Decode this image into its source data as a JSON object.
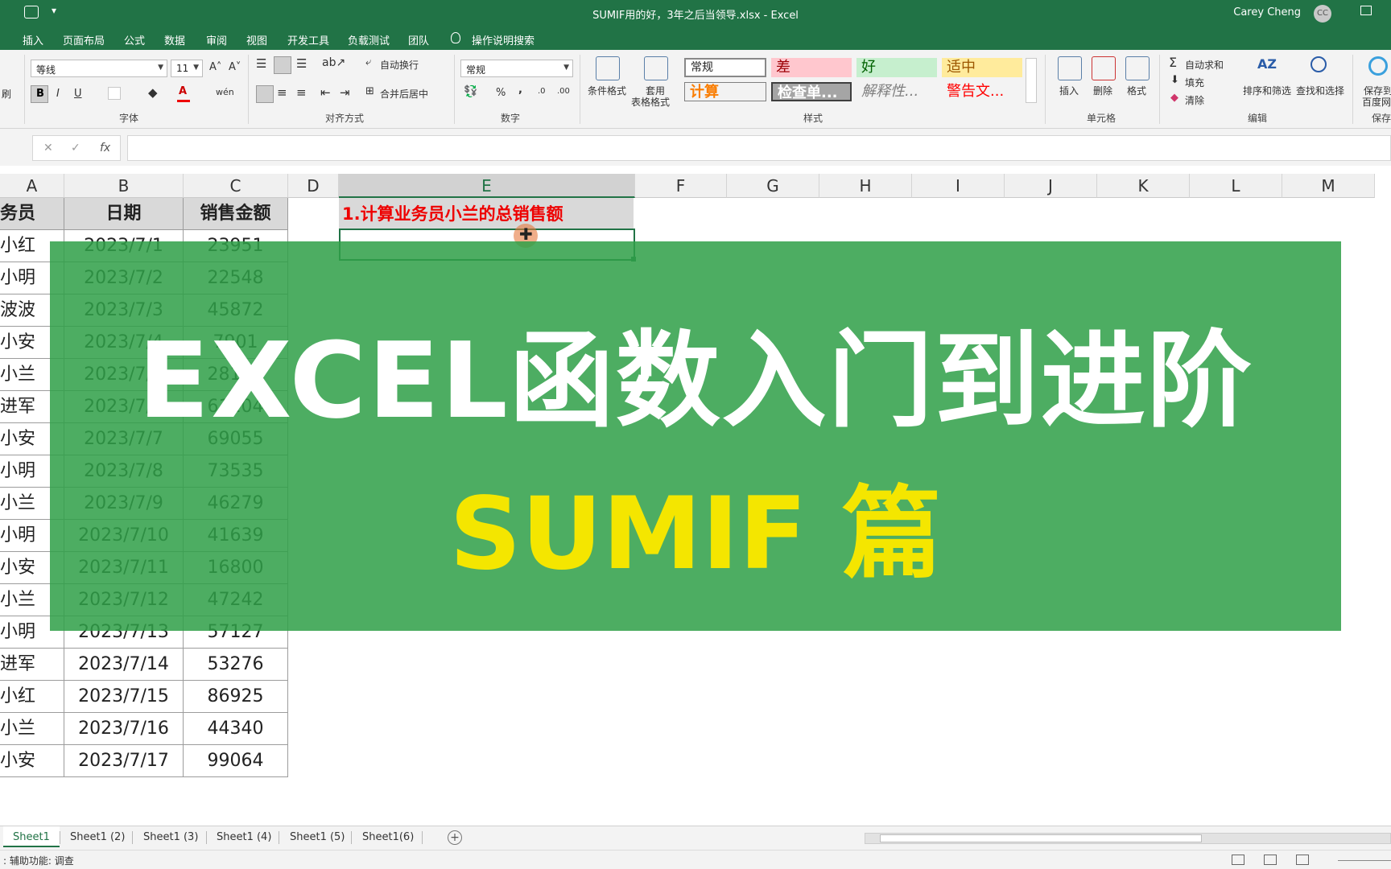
{
  "window": {
    "title": "SUMIF用的好，3年之后当领导.xlsx  -  Excel",
    "user": "Carey Cheng",
    "avatar_initials": "CC",
    "qa_more": "▾"
  },
  "tabs": [
    "插入",
    "页面布局",
    "公式",
    "数据",
    "审阅",
    "视图",
    "开发工具",
    "负载测试",
    "团队",
    "操作说明搜索"
  ],
  "ribbon": {
    "clipboard_label": "刷",
    "font": {
      "name": "等线",
      "size": "11",
      "grow": "A˄",
      "shrink": "A˅",
      "bold": "B",
      "italic": "I",
      "underline": "U",
      "color_a": "A",
      "wen": "wén",
      "group_label": "字体"
    },
    "align": {
      "wrap_label": "自动换行",
      "merge_label": "合并后居中",
      "group_label": "对齐方式"
    },
    "number": {
      "format": "常规",
      "percent": "%",
      "comma": ",",
      "inc_decimal": "←.0\n.00",
      "dec_decimal": ".00\n→.0",
      "group_label": "数字"
    },
    "styles": {
      "cond_format": "条件格式",
      "table_format_1": "套用",
      "table_format_2": "表格格式",
      "normal": "常规",
      "bad": "差",
      "good": "好",
      "neutral": "适中",
      "calc": "计算",
      "check": "检查单...",
      "explain": "解释性...",
      "warn": "警告文...",
      "group_label": "样式"
    },
    "cells": {
      "insert": "插入",
      "delete": "删除",
      "format": "格式",
      "group_label": "单元格"
    },
    "editing": {
      "autosum": "自动求和",
      "fill": "填充",
      "clear": "清除",
      "sort": "排序和筛选",
      "find": "查找和选择",
      "group_label": "编辑"
    },
    "save": {
      "label1": "保存到",
      "label2": "百度网",
      "group_label": "保存"
    }
  },
  "formula_bar": {
    "cancel": "✕",
    "enter": "✓",
    "fx": "fx",
    "value": ""
  },
  "columns": [
    "A",
    "B",
    "C",
    "D",
    "E",
    "F",
    "G",
    "H",
    "I",
    "J",
    "K",
    "L",
    "M"
  ],
  "table": {
    "headers": [
      "务员",
      "日期",
      "销售金额"
    ],
    "rows": [
      [
        "小红",
        "2023/7/1",
        "23951"
      ],
      [
        "小明",
        "2023/7/2",
        "22548"
      ],
      [
        "波波",
        "2023/7/3",
        "45872"
      ],
      [
        "小安",
        "2023/7/4",
        "7901"
      ],
      [
        "小兰",
        "2023/7/5",
        "28176"
      ],
      [
        "进军",
        "2023/7/6",
        "61104"
      ],
      [
        "小安",
        "2023/7/7",
        "69055"
      ],
      [
        "小明",
        "2023/7/8",
        "73535"
      ],
      [
        "小兰",
        "2023/7/9",
        "46279"
      ],
      [
        "小明",
        "2023/7/10",
        "41639"
      ],
      [
        "小安",
        "2023/7/11",
        "16800"
      ],
      [
        "小兰",
        "2023/7/12",
        "47242"
      ],
      [
        "小明",
        "2023/7/13",
        "57127"
      ],
      [
        "进军",
        "2023/7/14",
        "53276"
      ],
      [
        "小红",
        "2023/7/15",
        "86925"
      ],
      [
        "小兰",
        "2023/7/16",
        "44340"
      ],
      [
        "小安",
        "2023/7/17",
        "99064"
      ]
    ]
  },
  "task": {
    "e1_text": "1.计算业务员小兰的总销售额"
  },
  "banner": {
    "line1": "EXCEL函数入门到进阶",
    "line2": "SUMIF 篇"
  },
  "sheets": [
    "Sheet1",
    "Sheet1 (2)",
    "Sheet1 (3)",
    "Sheet1 (4)",
    "Sheet1 (5)",
    "Sheet1(6)"
  ],
  "add_sheet": "+",
  "status": {
    "text": ": 辅助功能: 调查"
  },
  "colors": {
    "excel_green": "#217346",
    "banner_green": "#30a048",
    "banner_yellow": "#f4e600",
    "task_red": "#e00000"
  }
}
